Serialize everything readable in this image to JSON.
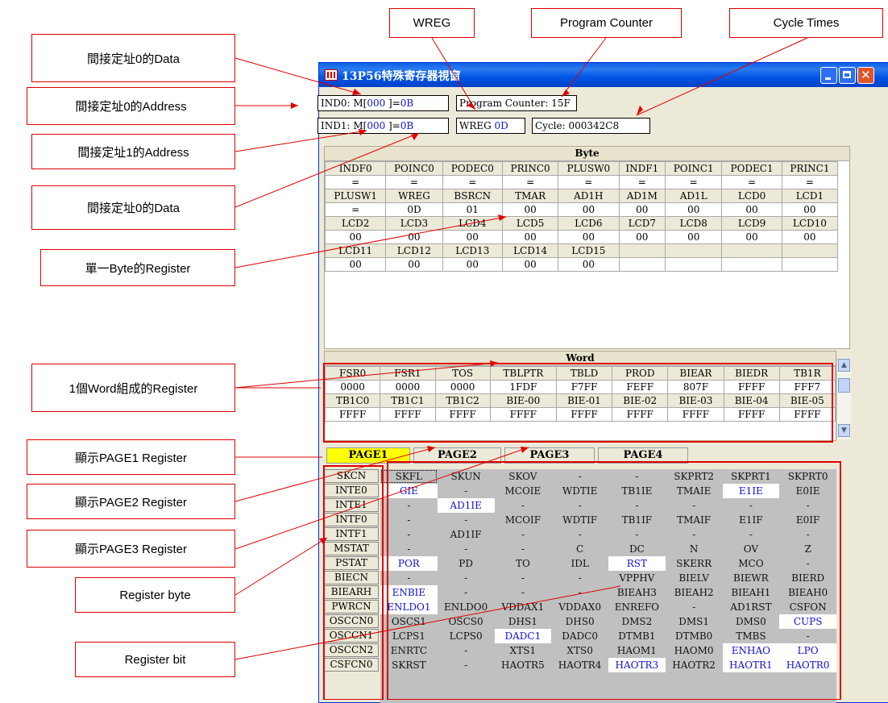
{
  "callouts": {
    "wreg": "WREG",
    "pc": "Program Counter",
    "cycle": "Cycle Times",
    "ind0_data": "間接定址0的Data",
    "ind0_addr": "間接定址0的Address",
    "ind1_addr": "間接定址1的Address",
    "ind0_data2": "間接定址0的Data",
    "single_byte": "單一Byte的Register",
    "word": "1個Word組成的Register",
    "page1": "顯示PAGE1 Register",
    "page2": "顯示PAGE2 Register",
    "page3": "顯示PAGE3 Register",
    "reg_byte": "Register byte",
    "reg_bit": "Register bit"
  },
  "window": {
    "title": "13P56特殊寄存器視窗"
  },
  "status": {
    "ind0_prefix": "IND0: M[",
    "ind0_addr": "000",
    "ind0_mid": " ]=",
    "ind0_val": "0B",
    "ind1_prefix": "IND1: M[",
    "ind1_addr": "000",
    "ind1_mid": " ]=",
    "ind1_val": "0B",
    "pc_label": "Program Counter: 15F",
    "wreg_label": "WREG",
    "wreg_val": "0D",
    "cycle_label": "Cycle: 000342C8"
  },
  "byte_panel": {
    "header": "Byte",
    "rows": [
      [
        "INDF0",
        "POINC0",
        "PODEC0",
        "PRINC0",
        "PLUSW0",
        "INDF1",
        "POINC1",
        "PODEC1",
        "PRINC1"
      ],
      [
        "=",
        "=",
        "=",
        "=",
        "=",
        "=",
        "=",
        "=",
        "="
      ],
      [
        "PLUSW1",
        "WREG",
        "BSRCN",
        "TMAR",
        "AD1H",
        "AD1M",
        "AD1L",
        "LCD0",
        "LCD1"
      ],
      [
        "=",
        "0D",
        "01",
        "00",
        "00",
        "00",
        "00",
        "00",
        "00"
      ],
      [
        "LCD2",
        "LCD3",
        "LCD4",
        "LCD5",
        "LCD6",
        "LCD7",
        "LCD8",
        "LCD9",
        "LCD10"
      ],
      [
        "00",
        "00",
        "00",
        "00",
        "00",
        "00",
        "00",
        "00",
        "00"
      ],
      [
        "LCD11",
        "LCD12",
        "LCD13",
        "LCD14",
        "LCD15",
        "",
        "",
        "",
        ""
      ],
      [
        "00",
        "00",
        "00",
        "00",
        "00",
        "",
        "",
        "",
        ""
      ]
    ]
  },
  "word_panel": {
    "header": "Word",
    "rows": [
      [
        "FSR0",
        "FSR1",
        "TOS",
        "TBLPTR",
        "TBLD",
        "PROD",
        "BIEAR",
        "BIEDR",
        "TB1R"
      ],
      [
        "0000",
        "0000",
        "0000",
        "1FDF",
        "F7FF",
        "FEFF",
        "807F",
        "FFFF",
        "FFF7"
      ],
      [
        "TB1C0",
        "TB1C1",
        "TB1C2",
        "BIE-00",
        "BIE-01",
        "BIE-02",
        "BIE-03",
        "BIE-04",
        "BIE-05"
      ],
      [
        "FFFF",
        "FFFF",
        "FFFF",
        "FFFF",
        "FFFF",
        "FFFF",
        "FFFF",
        "FFFF",
        "FFFF"
      ]
    ]
  },
  "scrollbar": {
    "up": "▲",
    "down": "▼"
  },
  "tabs": [
    "PAGE1",
    "PAGE2",
    "PAGE3",
    "PAGE4"
  ],
  "registers": [
    "SKCN",
    "INTE0",
    "INTE1",
    "INTF0",
    "INTF1",
    "MSTAT",
    "PSTAT",
    "BIECN",
    "BIEARH",
    "PWRCN",
    "OSCCN0",
    "OSCCN1",
    "OSCCN2",
    "CSFCN0"
  ],
  "bits": [
    [
      "SKFL",
      "SKUN",
      "SKOV",
      "-",
      "-",
      "SKPRT2",
      "SKPRT1",
      "SKPRT0"
    ],
    [
      "GIE",
      "-",
      "MCOIE",
      "WDTIE",
      "TB1IE",
      "TMAIE",
      "E1IE",
      "E0IE"
    ],
    [
      "-",
      "AD1IE",
      "-",
      "-",
      "-",
      "-",
      "-",
      "-"
    ],
    [
      "-",
      "-",
      "MCOIF",
      "WDTIF",
      "TB1IF",
      "TMAIF",
      "E1IF",
      "E0IF"
    ],
    [
      "-",
      "AD1IF",
      "-",
      "-",
      "-",
      "-",
      "-",
      "-"
    ],
    [
      "-",
      "-",
      "-",
      "C",
      "DC",
      "N",
      "OV",
      "Z"
    ],
    [
      "POR",
      "PD",
      "TO",
      "IDL",
      "RST",
      "SKERR",
      "MCO",
      "-"
    ],
    [
      "-",
      "-",
      "-",
      "-",
      "VPPHV",
      "BIELV",
      "BIEWR",
      "BIERD"
    ],
    [
      "ENBIE",
      "-",
      "-",
      "-",
      "BIEAH3",
      "BIEAH2",
      "BIEAH1",
      "BIEAH0"
    ],
    [
      "ENLDO1",
      "ENLDO0",
      "VDDAX1",
      "VDDAX0",
      "ENREFO",
      "-",
      "AD1RST",
      "CSFON"
    ],
    [
      "OSCS1",
      "OSCS0",
      "DHS1",
      "DHS0",
      "DMS2",
      "DMS1",
      "DMS0",
      "CUPS"
    ],
    [
      "LCPS1",
      "LCPS0",
      "DADC1",
      "DADC0",
      "DTMB1",
      "DTMB0",
      "TMBS",
      "-"
    ],
    [
      "ENRTC",
      "-",
      "XTS1",
      "XTS0",
      "HAOM1",
      "HAOM0",
      "ENHAO",
      "LPO"
    ],
    [
      "SKRST",
      "-",
      "HAOTR5",
      "HAOTR4",
      "HAOTR3",
      "HAOTR2",
      "HAOTR1",
      "HAOTR0"
    ]
  ],
  "bits_on": [
    "1-0",
    "1-6",
    "2-1",
    "6-0",
    "6-4",
    "8-0",
    "9-0",
    "10-7",
    "11-2",
    "12-6",
    "12-7",
    "13-4",
    "13-6",
    "13-7"
  ],
  "colors": {
    "callout_border": "#e00000",
    "active_tab": "#ffff00",
    "bit_on_text": "#1010d0"
  }
}
